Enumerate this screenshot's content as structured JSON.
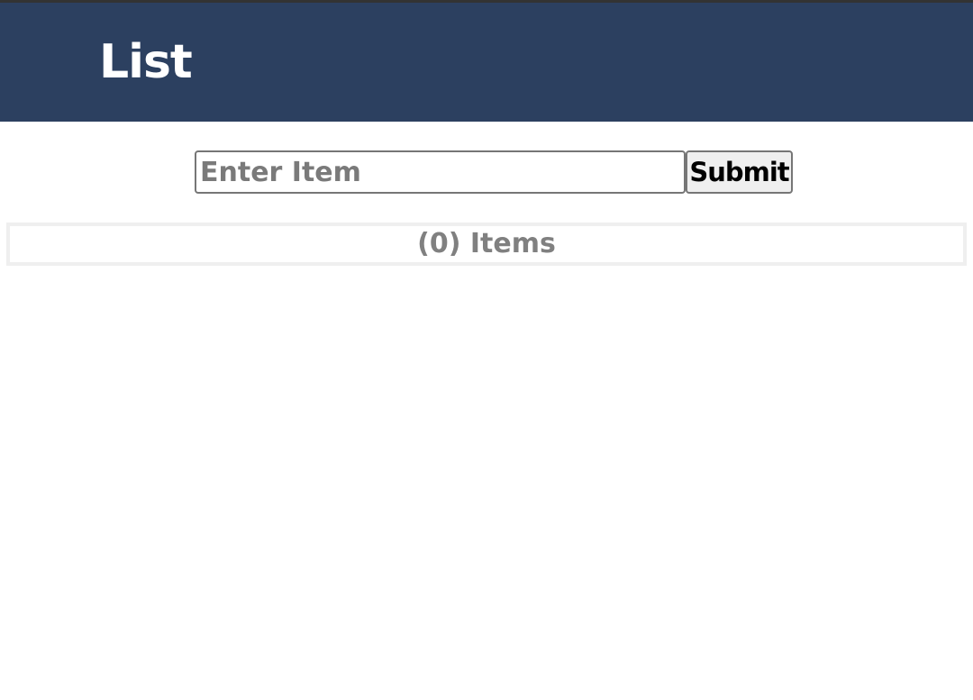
{
  "header": {
    "title": "List"
  },
  "form": {
    "input_placeholder": "Enter Item",
    "input_value": "",
    "submit_label": "Submit"
  },
  "list": {
    "count_label": "(0) Items",
    "items": []
  },
  "colors": {
    "header_background": "#2c4060",
    "title_text": "#ffffff",
    "placeholder_text": "#7a7a7a",
    "count_text": "#808080",
    "button_background": "#efefef",
    "count_border": "#efefef"
  }
}
